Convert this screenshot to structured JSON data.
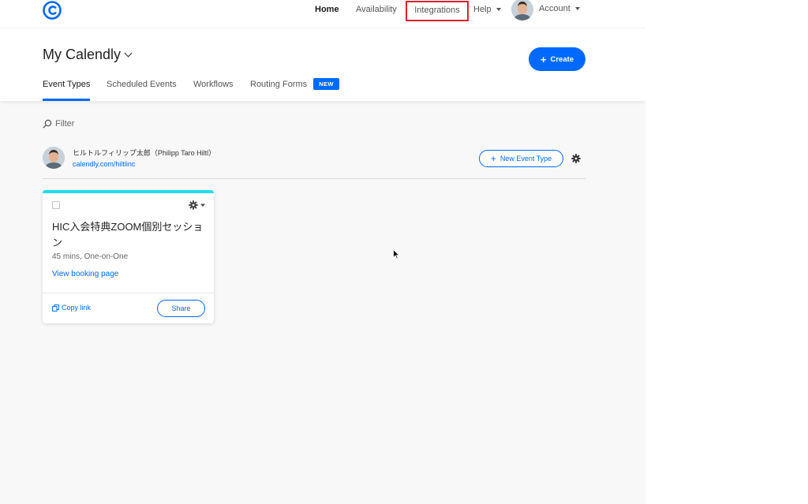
{
  "nav": {
    "home": "Home",
    "availability": "Availability",
    "integrations": "Integrations",
    "help": "Help",
    "account": "Account"
  },
  "header": {
    "title": "My Calendly",
    "create_label": "Create"
  },
  "tabs": [
    {
      "label": "Event Types",
      "active": true
    },
    {
      "label": "Scheduled Events",
      "active": false
    },
    {
      "label": "Workflows",
      "active": false
    },
    {
      "label": "Routing Forms",
      "active": false,
      "badge": "NEW"
    }
  ],
  "filter": {
    "label": "Filter"
  },
  "user": {
    "name": "ヒルトルフィリップ太郎（Philipp Taro Hiltl）",
    "url": "calendly.com/hiltlinc",
    "new_event_type_label": "New Event Type"
  },
  "event_card": {
    "title": "HIC入会特典ZOOM個別セッション",
    "meta": "45 mins, One-on-One",
    "booking_link": "View booking page",
    "copy_link": "Copy link",
    "share": "Share",
    "accent_color": "#1fdcec"
  },
  "colors": {
    "brand_blue": "#0069ff",
    "highlight_red": "#e0202a"
  }
}
